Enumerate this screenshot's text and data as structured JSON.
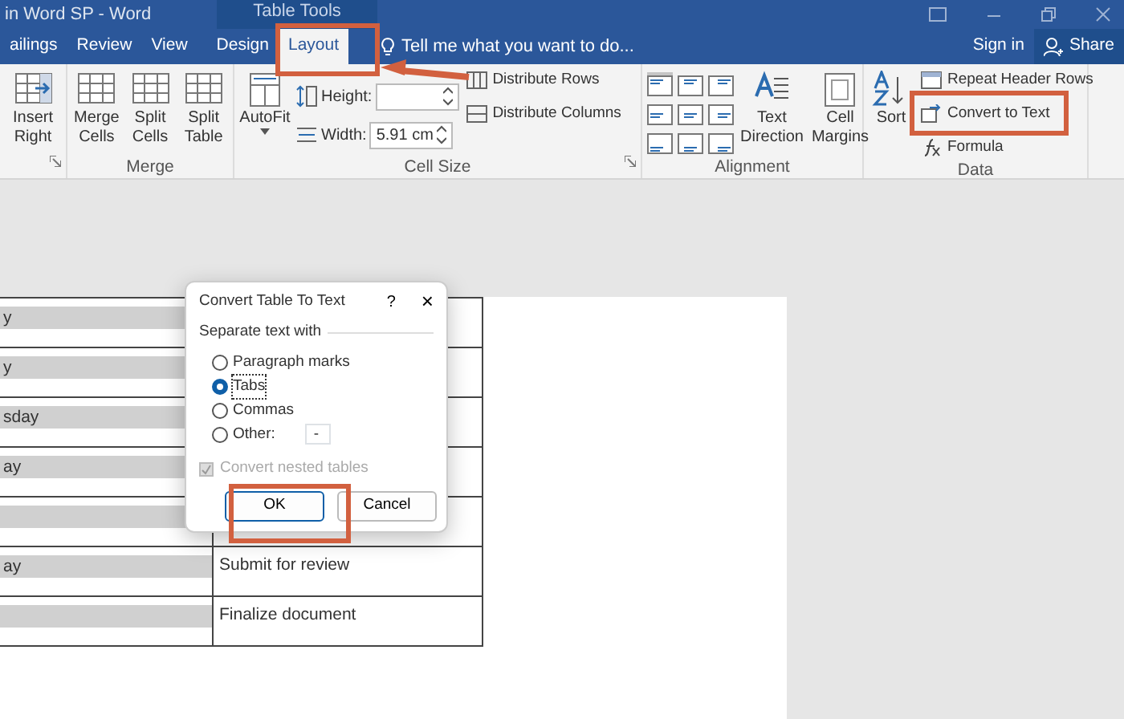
{
  "window": {
    "title": "in Word SP - Word",
    "context_title": "Table Tools"
  },
  "tabs": [
    {
      "label": "ailings",
      "selected": false
    },
    {
      "label": "Review",
      "selected": false
    },
    {
      "label": "View",
      "selected": false
    },
    {
      "label": "Design",
      "selected": false
    },
    {
      "label": "Layout",
      "selected": true
    }
  ],
  "tell_me": "Tell me what you want to do...",
  "account": {
    "sign_in": "Sign in",
    "share": "Share"
  },
  "ribbon": [
    {
      "launcher": true,
      "items": [
        {
          "kind": "large",
          "label": "Insert Right"
        }
      ]
    },
    {
      "label": "Merge",
      "launcher": false,
      "items": [
        {
          "kind": "large",
          "label": "Merge Cells"
        },
        {
          "kind": "large",
          "label": "Split Cells"
        },
        {
          "kind": "large",
          "label": "Split Table"
        }
      ]
    },
    {
      "label": "Cell Size",
      "launcher": true,
      "items": [
        {
          "kind": "large",
          "label": "AutoFit",
          "dropdown": true
        },
        {
          "kind": "spin",
          "label": "Height:"
        },
        {
          "kind": "spin",
          "label": "Width:",
          "value": "5.91 cm"
        },
        {
          "kind": "small",
          "label": "Distribute Rows"
        },
        {
          "kind": "small",
          "label": "Distribute Columns"
        }
      ]
    },
    {
      "label": "Alignment",
      "launcher": false,
      "items": [
        {
          "kind": "align-grid",
          "cells": [
            {
              "selected": true
            },
            {
              "selected": false
            },
            {
              "selected": false
            },
            {
              "selected": false
            },
            {
              "selected": false
            },
            {
              "selected": false
            },
            {
              "selected": false
            },
            {
              "selected": false
            },
            {
              "selected": false
            }
          ]
        },
        {
          "kind": "large",
          "label": "Text Direction"
        },
        {
          "kind": "large",
          "label": "Cell Margins"
        }
      ]
    },
    {
      "label": "Data",
      "launcher": false,
      "items": [
        {
          "kind": "large",
          "label": "Sort"
        },
        {
          "kind": "small",
          "label": "Repeat Header Rows"
        },
        {
          "kind": "small",
          "label": "Convert to Text"
        },
        {
          "kind": "small",
          "label": "Formula"
        }
      ]
    }
  ],
  "table": {
    "rows": [
      {
        "cell_1": "y"
      },
      {
        "cell_1": "y"
      },
      {
        "cell_1": "sday"
      },
      {
        "cell_1": "ay"
      },
      {},
      {
        "cell_1": "ay",
        "cell_2": "Submit for review"
      },
      {
        "cell_2": "Finalize document"
      }
    ]
  },
  "dialog": {
    "title": "Convert Table To Text",
    "help": "?",
    "close": "×",
    "group_label": "Separate text with",
    "options": [
      {
        "label": "Paragraph marks",
        "selected": false
      },
      {
        "label": "Tabs",
        "selected": true
      },
      {
        "label": "Commas",
        "selected": false
      },
      {
        "label": "Other:",
        "selected": false,
        "value": "-"
      }
    ],
    "nested": {
      "label": "Convert nested tables",
      "checked": true,
      "disabled": true
    },
    "buttons": [
      {
        "label": "OK",
        "default": true
      },
      {
        "label": "Cancel",
        "default": false
      }
    ]
  }
}
